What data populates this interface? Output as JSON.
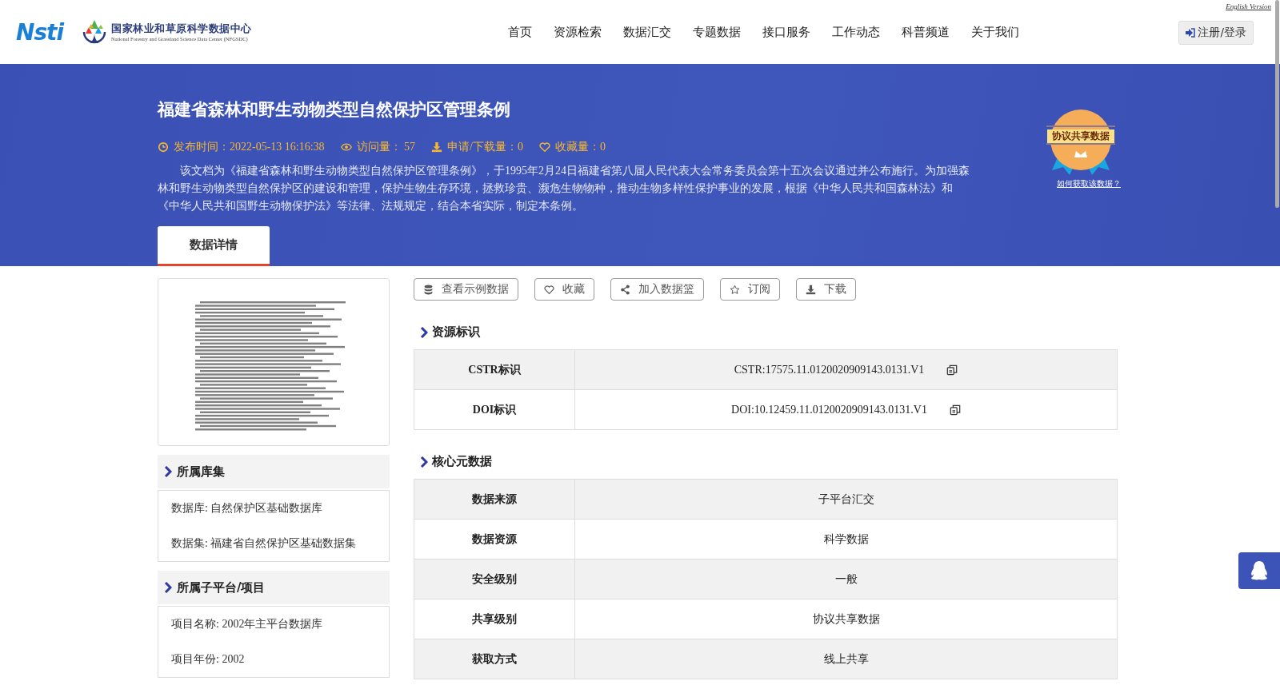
{
  "header": {
    "logo_text": "Nsti",
    "org_name": "国家林业和草原科学数据中心",
    "org_name_en": "National Forestry and Grassland Science Data Center (NFGSDC)",
    "language_link": "English Version",
    "nav": [
      {
        "label": "首页"
      },
      {
        "label": "资源检索"
      },
      {
        "label": "数据汇交"
      },
      {
        "label": "专题数据"
      },
      {
        "label": "接口服务"
      },
      {
        "label": "工作动态"
      },
      {
        "label": "科普频道"
      },
      {
        "label": "关于我们"
      }
    ],
    "login_button": "注册/登录"
  },
  "dataset": {
    "title": "福建省森林和野生动物类型自然保护区管理条例",
    "meta": [
      {
        "kind": "time",
        "text": "发布时间：2022-05-13 16:16:38"
      },
      {
        "kind": "views",
        "text": "访问量： 57"
      },
      {
        "kind": "downloads",
        "text": "申请/下载量：0"
      },
      {
        "kind": "favorites",
        "text": "收藏量：0"
      }
    ],
    "description": "该文档为《福建省森林和野生动物类型自然保护区管理条例》，于1995年2月24日福建省第八届人民代表大会常务委员会第十五次会议通过并公布施行。为加强森林和野生动物类型自然保护区的建设和管理，保护生物生存环境，拯救珍贵、濒危生物物种，推动生物多样性保护事业的发展，根据《中华人民共和国森林法》和《中华人民共和国野生动物保护法》等法律、法规规定，结合本省实际，制定本条例。",
    "badge": {
      "label": "协议共享数据",
      "link": "如何获取该数据？"
    }
  },
  "tabs": [
    {
      "label": "数据详情",
      "selected": true
    }
  ],
  "actions": [
    {
      "kind": "sample",
      "label": "查看示例数据"
    },
    {
      "kind": "favorite",
      "label": "收藏"
    },
    {
      "kind": "basket",
      "label": "加入数据篮"
    },
    {
      "kind": "subscribe",
      "label": "订阅"
    },
    {
      "kind": "download",
      "label": "下载"
    }
  ],
  "sidebar": {
    "sections": [
      {
        "title": "所属库集",
        "items": [
          "数据库: 自然保护区基础数据库",
          "数据集: 福建省自然保护区基础数据集"
        ]
      },
      {
        "title": "所属子平台/项目",
        "items": [
          "项目名称: 2002年主平台数据库",
          "项目年份: 2002"
        ]
      }
    ]
  },
  "identifiers": {
    "title": "资源标识",
    "rows": [
      {
        "label": "CSTR标识",
        "value": "CSTR:17575.11.0120020909143.0131.V1"
      },
      {
        "label": "DOI标识",
        "value": "DOI:10.12459.11.0120020909143.0131.V1"
      }
    ]
  },
  "core_metadata": {
    "title": "核心元数据",
    "rows": [
      {
        "label": "数据来源",
        "value": "子平台汇交"
      },
      {
        "label": "数据资源",
        "value": "科学数据"
      },
      {
        "label": "安全级别",
        "value": "一般"
      },
      {
        "label": "共享级别",
        "value": "协议共享数据"
      },
      {
        "label": "获取方式",
        "value": "线上共享"
      }
    ]
  }
}
